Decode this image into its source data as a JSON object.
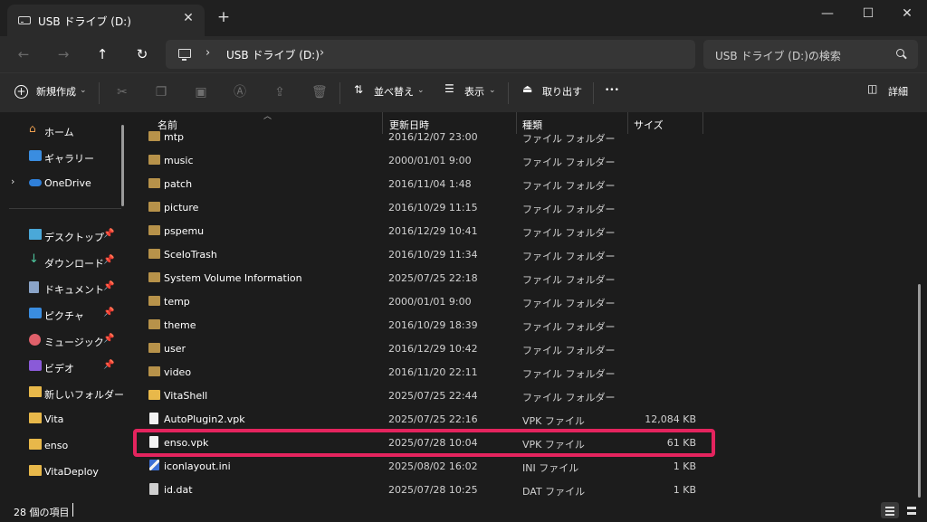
{
  "tab": {
    "title": "USB ドライブ (D:)",
    "close": "✕",
    "new": "+"
  },
  "window": {
    "minimize": "—",
    "maximize": "☐",
    "close": "✕"
  },
  "nav": {
    "back": "←",
    "forward": "→",
    "up": "↑",
    "refresh": "↻"
  },
  "address": {
    "breadcrumb": "USB ドライブ (D:)",
    "chev1": "›",
    "chev2": "›"
  },
  "search": {
    "placeholder": "USB ドライブ (D:)の検索"
  },
  "commandbar": {
    "new_label": "新規作成",
    "sort_label": "並べ替え",
    "view_label": "表示",
    "eject_label": "取り出す",
    "more": "•••",
    "details_label": "詳細"
  },
  "sidebar": {
    "home": "ホーム",
    "gallery": "ギャラリー",
    "onedrive": "OneDrive",
    "pinned": [
      {
        "label": "デスクトップ",
        "icon": "desktop-icon"
      },
      {
        "label": "ダウンロード",
        "icon": "download-icon"
      },
      {
        "label": "ドキュメント",
        "icon": "documents-icon"
      },
      {
        "label": "ピクチャ",
        "icon": "pictures-icon"
      },
      {
        "label": "ミュージック",
        "icon": "music-icon"
      },
      {
        "label": "ビデオ",
        "icon": "video-icon"
      }
    ],
    "folders": [
      "新しいフォルダー",
      "Vita",
      "enso",
      "VitaDeploy"
    ]
  },
  "columns": {
    "name": "名前",
    "date": "更新日時",
    "type": "種類",
    "size": "サイズ"
  },
  "files": [
    {
      "name": "mtp",
      "date": "2016/12/07 23:00",
      "type": "ファイル フォルダー",
      "size": "",
      "kind": "folder"
    },
    {
      "name": "music",
      "date": "2000/01/01 9:00",
      "type": "ファイル フォルダー",
      "size": "",
      "kind": "folder"
    },
    {
      "name": "patch",
      "date": "2016/11/04 1:48",
      "type": "ファイル フォルダー",
      "size": "",
      "kind": "folder"
    },
    {
      "name": "picture",
      "date": "2016/10/29 11:15",
      "type": "ファイル フォルダー",
      "size": "",
      "kind": "folder"
    },
    {
      "name": "pspemu",
      "date": "2016/12/29 10:41",
      "type": "ファイル フォルダー",
      "size": "",
      "kind": "folder"
    },
    {
      "name": "SceIoTrash",
      "date": "2016/10/29 11:34",
      "type": "ファイル フォルダー",
      "size": "",
      "kind": "folder"
    },
    {
      "name": "System Volume Information",
      "date": "2025/07/25 22:18",
      "type": "ファイル フォルダー",
      "size": "",
      "kind": "folder"
    },
    {
      "name": "temp",
      "date": "2000/01/01 9:00",
      "type": "ファイル フォルダー",
      "size": "",
      "kind": "folder"
    },
    {
      "name": "theme",
      "date": "2016/10/29 18:39",
      "type": "ファイル フォルダー",
      "size": "",
      "kind": "folder"
    },
    {
      "name": "user",
      "date": "2016/12/29 10:42",
      "type": "ファイル フォルダー",
      "size": "",
      "kind": "folder"
    },
    {
      "name": "video",
      "date": "2016/11/20 22:11",
      "type": "ファイル フォルダー",
      "size": "",
      "kind": "folder"
    },
    {
      "name": "VitaShell",
      "date": "2025/07/25 22:44",
      "type": "ファイル フォルダー",
      "size": "",
      "kind": "folder-yellow"
    },
    {
      "name": "AutoPlugin2.vpk",
      "date": "2025/07/25 22:16",
      "type": "VPK ファイル",
      "size": "12,084 KB",
      "kind": "file"
    },
    {
      "name": "enso.vpk",
      "date": "2025/07/28 10:04",
      "type": "VPK ファイル",
      "size": "61 KB",
      "kind": "file"
    },
    {
      "name": "iconlayout.ini",
      "date": "2025/08/02 16:02",
      "type": "INI ファイル",
      "size": "1 KB",
      "kind": "img"
    },
    {
      "name": "id.dat",
      "date": "2025/07/28 10:25",
      "type": "DAT ファイル",
      "size": "1 KB",
      "kind": "dat"
    }
  ],
  "status": {
    "count": "28 個の項目"
  }
}
